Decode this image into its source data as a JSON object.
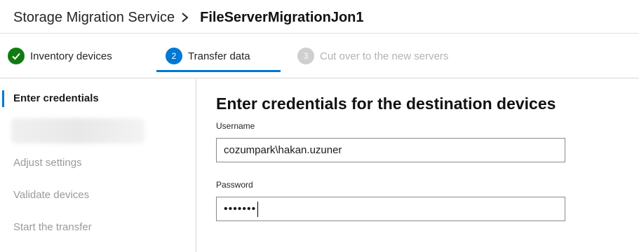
{
  "header": {
    "breadcrumb_root": "Storage Migration Service",
    "breadcrumb_current": "FileServerMigrationJon1",
    "separator_icon": "chevron-right-icon"
  },
  "steps": [
    {
      "number": "",
      "label": "Inventory devices",
      "state": "completed",
      "icon": "check-icon"
    },
    {
      "number": "2",
      "label": "Transfer data",
      "state": "active"
    },
    {
      "number": "3",
      "label": "Cut over to the new servers",
      "state": "disabled"
    }
  ],
  "leftnav": {
    "items": [
      {
        "label": "Enter credentials",
        "state": "active"
      },
      {
        "label": "Adjust settings",
        "state": "inactive"
      },
      {
        "label": "Validate devices",
        "state": "inactive"
      },
      {
        "label": "Start the transfer",
        "state": "inactive"
      }
    ]
  },
  "main": {
    "title": "Enter credentials for the destination devices",
    "username_label": "Username",
    "username_value": "cozumpark\\hakan.uzuner",
    "password_label": "Password",
    "password_mask": "•••••••"
  },
  "colors": {
    "accent": "#0078d4",
    "success": "#107c10",
    "disabled": "#cfcfcf"
  }
}
